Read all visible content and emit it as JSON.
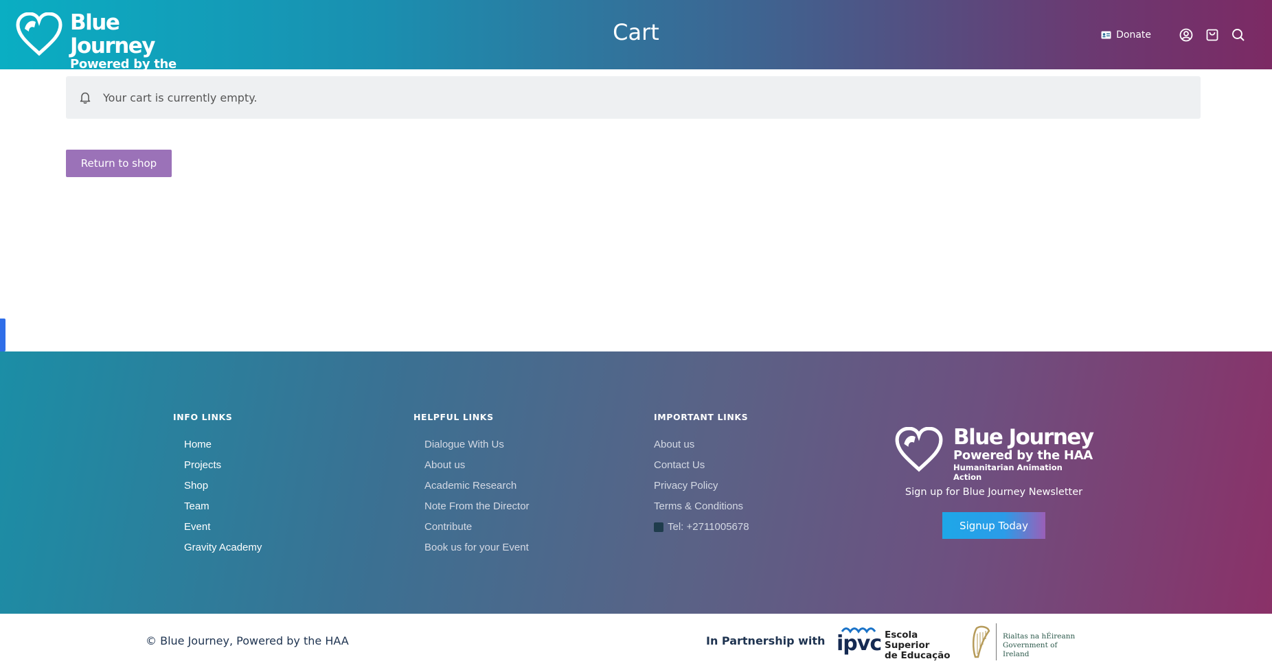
{
  "brand": {
    "name": "Blue Journey",
    "tagline": "Powered by the HAA",
    "subtagline": "Humanitarian Animation Action"
  },
  "header": {
    "title": "Cart",
    "donate_label": "Donate",
    "icons": [
      "user-icon",
      "cart-icon",
      "search-icon"
    ]
  },
  "cart": {
    "empty_message": "Your cart is currently empty.",
    "return_button": "Return to shop"
  },
  "footer": {
    "info": {
      "heading": "INFO LINKS",
      "links": [
        "Home",
        "Projects",
        "Shop",
        "Team",
        "Event",
        "Gravity Academy"
      ]
    },
    "helpful": {
      "heading": "HELPFUL LINKS",
      "links": [
        "Dialogue With Us",
        "About us",
        "Academic Research",
        "Note From the Director",
        "Contribute",
        "Book us for your Event"
      ]
    },
    "important": {
      "heading": "IMPORTANT LINKS",
      "links": [
        "About us",
        "Contact Us",
        "Privacy Policy",
        "Terms & Conditions"
      ],
      "tel": "Tel: +2711005678"
    },
    "newsletter_text": "Sign up for Blue Journey Newsletter",
    "signup_button": "Signup Today"
  },
  "bottom": {
    "copyright": "© Blue Journey, Powered by the HAA",
    "partner_label": "In Partnership with",
    "ipvc_mark": "ipvc",
    "ipvc_line1": "Escola Superior",
    "ipvc_line2": "de Educação",
    "gov_line1": "Rialtas na hÉireann",
    "gov_line2": "Government of Ireland"
  },
  "colors": {
    "header_start": "#0aaec3",
    "header_end": "#7c2a64",
    "button_purple": "#9b72b8",
    "notice_bg": "#eef0f2",
    "signup_blue": "#1ea7e8"
  }
}
